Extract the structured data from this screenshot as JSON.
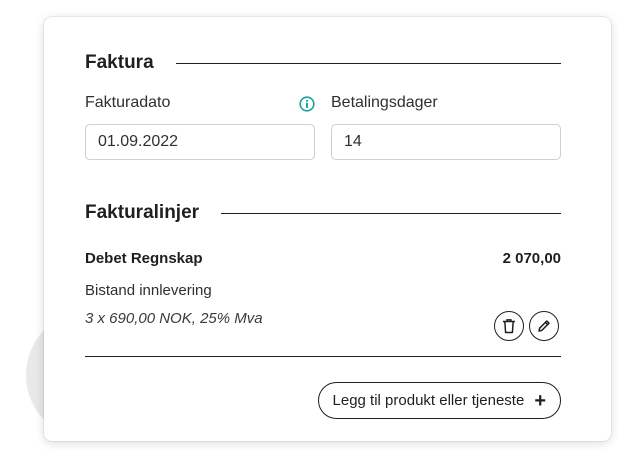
{
  "invoice": {
    "title": "Faktura",
    "date_label": "Fakturadato",
    "date_value": "01.09.2022",
    "payment_days_label": "Betalingsdager",
    "payment_days_value": "14",
    "info_icon": "info-circle-icon"
  },
  "invoice_lines": {
    "title": "Fakturalinjer",
    "lines": [
      {
        "name": "Debet Regnskap",
        "amount": "2 070,00",
        "description": "Bistand innlevering",
        "details": "3 x 690,00 NOK, 25% Mva"
      }
    ],
    "delete_icon": "trash-icon",
    "edit_icon": "pencil-icon"
  },
  "add_button": {
    "label": "Legg til produkt eller tjeneste",
    "icon": "+"
  },
  "colors": {
    "info_accent": "#1aa39a",
    "text": "#1f1f1f",
    "input_border": "#cfcfcf"
  }
}
